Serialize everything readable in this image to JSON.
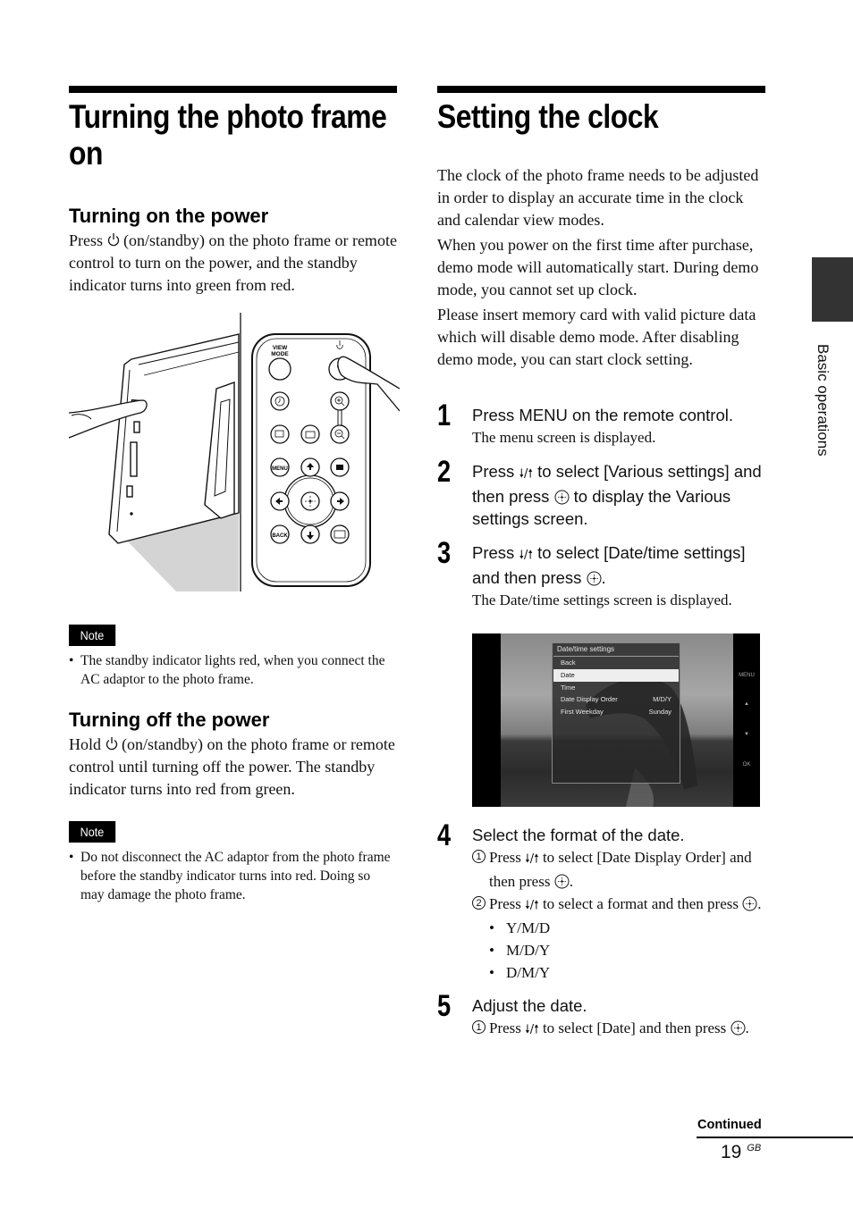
{
  "left": {
    "title": "Turning the photo frame on",
    "section_on": {
      "heading": "Turning on the power",
      "text_before_icon": "Press",
      "text_after_icon": "(on/standby) on the photo frame or remote control to turn on the power, and the standby indicator turns into green from red."
    },
    "illustration": {
      "remote_labels": {
        "view_mode_line1": "VIEW",
        "view_mode_line2": "MODE",
        "menu": "MENU",
        "back": "BACK"
      }
    },
    "note1": {
      "badge": "Note",
      "items": [
        "The standby indicator lights red, when you connect the AC adaptor to the photo frame."
      ]
    },
    "section_off": {
      "heading": "Turning off the power",
      "text_before_icon": "Hold",
      "text_after_icon": "(on/standby) on the photo frame or remote control until turning off the power. The standby indicator turns into red from green."
    },
    "note2": {
      "badge": "Note",
      "items": [
        "Do not disconnect the AC adaptor from the photo frame before the standby indicator turns into red. Doing so may damage the photo frame."
      ]
    }
  },
  "right": {
    "title": "Setting the clock",
    "paragraphs": [
      "The clock of the photo frame needs to be adjusted in order to display an accurate time in the clock and calendar view modes.",
      "When you power on the first time after purchase, demo mode will automatically start. During demo mode, you cannot set up clock.",
      "Please insert memory card with valid picture data which will disable demo mode. After disabling demo mode, you can start clock setting."
    ],
    "steps": [
      {
        "num": "1",
        "title": "Press MENU on the remote control.",
        "result": "The menu screen is displayed."
      },
      {
        "num": "2",
        "title_a": "Press",
        "arrows": "🠗/🠕",
        "title_b": "to select [Various settings] and then press",
        "title_c": "to display the Various settings screen."
      },
      {
        "num": "3",
        "title_a": "Press",
        "arrows": "🠗/🠕",
        "title_b": "to select [Date/time settings] and then press",
        "title_c": ".",
        "result": "The Date/time settings screen is displayed."
      },
      {
        "num": "4",
        "title": "Select the format of the date.",
        "substeps": [
          {
            "marker": "1",
            "text_a": "Press",
            "arrows": "🠗/🠕",
            "text_b": "to select [Date Display Order] and then press",
            "text_c": "."
          },
          {
            "marker": "2",
            "text_a": "Press",
            "arrows": "🠗/🠕",
            "text_b": "to select a format and then press",
            "text_c": "."
          }
        ],
        "options": [
          "Y/M/D",
          "M/D/Y",
          "D/M/Y"
        ]
      },
      {
        "num": "5",
        "title": "Adjust the date.",
        "substeps": [
          {
            "marker": "1",
            "text_a": "Press",
            "arrows": "🠗/🠕",
            "text_b": "to select [Date] and then press",
            "text_c": "."
          }
        ]
      }
    ],
    "screen": {
      "dialog_title": "Date/time settings",
      "rows": [
        {
          "label": "Back",
          "value": "",
          "selected": false
        },
        {
          "label": "Date",
          "value": "",
          "selected": true
        },
        {
          "label": "Time",
          "value": "",
          "selected": false
        },
        {
          "label": "Date Display Order",
          "value": "M/D/Y",
          "selected": false
        },
        {
          "label": "First Weekday",
          "value": "Sunday",
          "selected": false
        }
      ],
      "side_buttons": [
        "MENU",
        "▲",
        "▼",
        "OK"
      ]
    }
  },
  "sidebar": {
    "section_label": "Basic operations"
  },
  "footer": {
    "continued": "Continued",
    "page_number": "19",
    "page_suffix": "GB"
  }
}
